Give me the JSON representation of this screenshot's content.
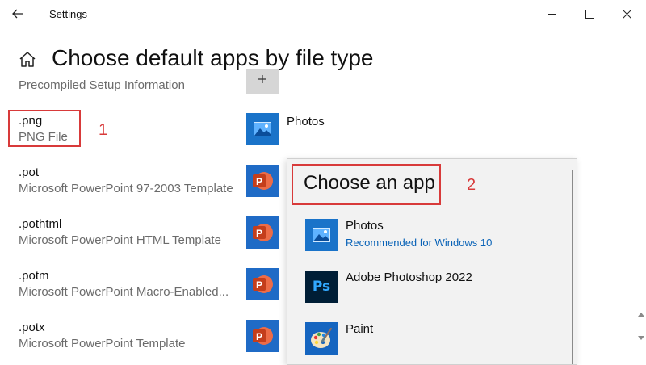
{
  "window": {
    "title": "Settings",
    "controls": [
      "minimize",
      "maximize",
      "close"
    ]
  },
  "page": {
    "title": "Choose default apps by file type"
  },
  "file_types": [
    {
      "ext": "",
      "description": "Precompiled Setup Information",
      "app": "",
      "icon": "plus-icon"
    },
    {
      "ext": ".png",
      "description": "PNG File",
      "app": "Photos",
      "icon": "photos-icon"
    },
    {
      "ext": ".pot",
      "description": "Microsoft PowerPoint 97-2003 Template",
      "app": "",
      "icon": "powerpoint-icon"
    },
    {
      "ext": ".pothtml",
      "description": "Microsoft PowerPoint HTML Template",
      "app": "",
      "icon": "powerpoint-icon"
    },
    {
      "ext": ".potm",
      "description": "Microsoft PowerPoint Macro-Enabled...",
      "app": "",
      "icon": "powerpoint-icon"
    },
    {
      "ext": ".potx",
      "description": "Microsoft PowerPoint Template",
      "app": "",
      "icon": "powerpoint-icon"
    }
  ],
  "annotations": {
    "marker_1": "1",
    "marker_2": "2",
    "color": "#d83a3a"
  },
  "flyout": {
    "title": "Choose an app",
    "apps": [
      {
        "name": "Photos",
        "subtitle": "Recommended for Windows 10",
        "icon": "photos-icon"
      },
      {
        "name": "Adobe Photoshop 2022",
        "subtitle": "",
        "icon": "photoshop-icon",
        "icon_text": "Ps"
      },
      {
        "name": "Paint",
        "subtitle": "",
        "icon": "paint-icon"
      }
    ]
  },
  "colors": {
    "photos_tile": "#1a73c9",
    "powerpoint_tile": "#1f6bc6",
    "powerpoint_badge": "#c43e1c",
    "accent_link": "#0a63b7"
  }
}
